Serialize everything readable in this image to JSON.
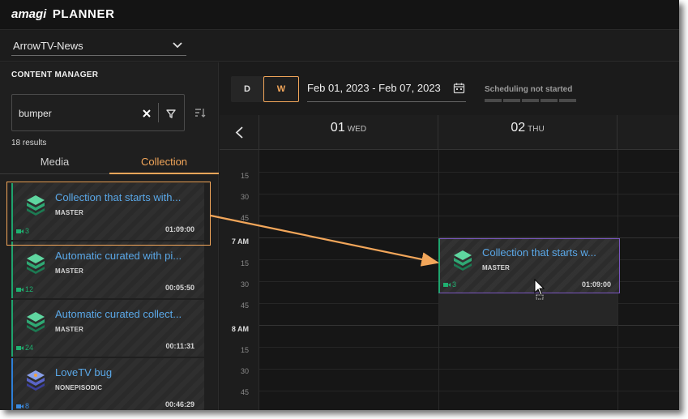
{
  "app": {
    "logo": "amagi",
    "product": "PLANNER"
  },
  "channel": {
    "selected": "ArrowTV-News"
  },
  "content_manager": {
    "title": "CONTENT MANAGER",
    "search": {
      "value": "bumper",
      "placeholder": ""
    },
    "results": "18 results",
    "tabs": [
      {
        "label": "Media"
      },
      {
        "label": "Collection"
      }
    ],
    "active_tab": "Collection",
    "items": [
      {
        "title": "Collection that starts with...",
        "type": "MASTER",
        "count": "3",
        "duration": "01:09:00",
        "accent": "#1fa46e",
        "icon": "collection-stack-icon"
      },
      {
        "title": "Automatic curated with pi...",
        "type": "MASTER",
        "count": "12",
        "duration": "00:05:50",
        "accent": "#1fa46e",
        "icon": "collection-stack-icon"
      },
      {
        "title": "Automatic curated collect...",
        "type": "MASTER",
        "count": "24",
        "duration": "00:11:31",
        "accent": "#1fa46e",
        "icon": "collection-stack-icon"
      },
      {
        "title": "LoveTV bug",
        "type": "NONEPISODIC",
        "count": "8",
        "duration": "00:46:29",
        "accent": "#2e7fd8",
        "icon": "nonepisodic-stack-icon"
      }
    ]
  },
  "toolbar": {
    "day_button": "D",
    "week_button": "W",
    "active_view": "W",
    "date_range": "Feb 01, 2023 - Feb 07, 2023",
    "schedule_status": "Scheduling not started"
  },
  "calendar": {
    "days": [
      {
        "num": "01",
        "dow": "WED"
      },
      {
        "num": "02",
        "dow": "THU"
      }
    ],
    "time_labels": [
      "15",
      "30",
      "45",
      "7 AM",
      "15",
      "30",
      "45",
      "8 AM",
      "15",
      "30",
      "45"
    ],
    "scheduled_item": {
      "title": "Collection that starts w...",
      "type": "MASTER",
      "count": "3",
      "duration": "01:09:00"
    }
  },
  "colors": {
    "accent": "#f2a65a",
    "link": "#5aa8e8",
    "master": "#1fa46e",
    "nonepisodic": "#2e7fd8",
    "selection": "#7b57c0"
  }
}
